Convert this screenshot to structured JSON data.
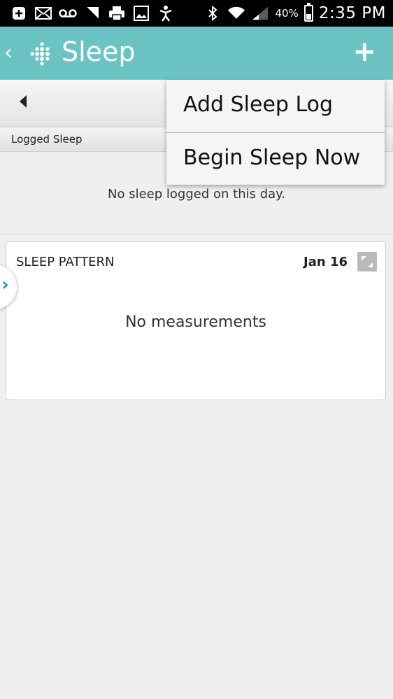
{
  "status_bar": {
    "battery_pct": "40%",
    "time": "2:35 PM",
    "icons": [
      "add-notification-icon",
      "mail-icon",
      "voicemail-icon",
      "signal-corner-icon",
      "printer-icon",
      "image-icon",
      "activity-icon",
      "bluetooth-icon",
      "wifi-icon",
      "cell-signal-icon",
      "battery-icon"
    ]
  },
  "app_bar": {
    "title": "Sleep",
    "back_icon": "chevron-left-icon",
    "logo_icon": "fitbit-logo-icon",
    "add_icon": "plus-icon",
    "accent_color": "#6cc3c3"
  },
  "date_bar": {
    "prev_icon": "triangle-left-icon"
  },
  "logged_sleep": {
    "header": "Logged Sleep",
    "empty_message": "No sleep logged on this day."
  },
  "sleep_pattern": {
    "title": "SLEEP PATTERN",
    "date": "Jan 16",
    "empty_message": "No measurements",
    "expand_icon": "expand-icon"
  },
  "side_tab": {
    "icon": "chevron-right-icon",
    "color": "#2a93b6"
  },
  "menu": {
    "items": [
      {
        "label": "Add Sleep Log"
      },
      {
        "label": "Begin Sleep Now"
      }
    ]
  }
}
